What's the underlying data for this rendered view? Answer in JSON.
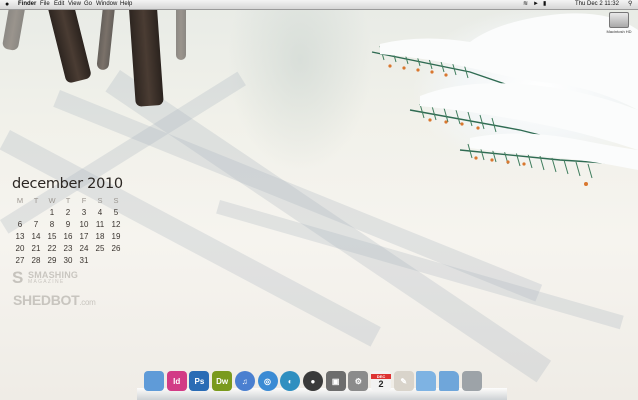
{
  "menubar": {
    "app": "Finder",
    "items": [
      "File",
      "Edit",
      "View",
      "Go",
      "Window",
      "Help"
    ],
    "clock": "Thu Dec 2  11:32",
    "spotlight_icon": "search-icon"
  },
  "desktop": {
    "hd_label": "Macintosh HD"
  },
  "calendar": {
    "title": "december 2010",
    "day_headers": [
      "M",
      "T",
      "W",
      "T",
      "F",
      "S",
      "S"
    ],
    "cells": [
      "",
      "",
      "1",
      "2",
      "3",
      "4",
      "5",
      "6",
      "7",
      "8",
      "9",
      "10",
      "11",
      "12",
      "13",
      "14",
      "15",
      "16",
      "17",
      "18",
      "19",
      "20",
      "21",
      "22",
      "23",
      "24",
      "25",
      "26",
      "27",
      "28",
      "29",
      "30",
      "31",
      "",
      ""
    ]
  },
  "branding": {
    "smashing_line1": "SMASHING",
    "smashing_line2": "MAGAZINE",
    "shedbot_name": "SHEDBOT",
    "shedbot_domain": ".com"
  },
  "dock": {
    "items": [
      {
        "name": "finder",
        "label": "",
        "color": "#5f9bd8"
      },
      {
        "name": "indesign",
        "label": "Id",
        "color": "#d23b86"
      },
      {
        "name": "photoshop",
        "label": "Ps",
        "color": "#2a6cb5"
      },
      {
        "name": "dreamweaver",
        "label": "Dw",
        "color": "#7a9a1d"
      },
      {
        "name": "itunes",
        "label": "♫",
        "color": "#4a7fd0"
      },
      {
        "name": "safari",
        "label": "◎",
        "color": "#3b8bd4"
      },
      {
        "name": "firefox",
        "label": "◐",
        "color": "#2f8fc0"
      },
      {
        "name": "camera",
        "label": "●",
        "color": "#3a3a3a"
      },
      {
        "name": "preview",
        "label": "▣",
        "color": "#6d6d6d"
      },
      {
        "name": "settings",
        "label": "⚙",
        "color": "#8b8b8b"
      },
      {
        "name": "calendar-app",
        "label": "2",
        "color": "#f2f2f2"
      },
      {
        "name": "utility",
        "label": "✎",
        "color": "#d9d4cb"
      },
      {
        "name": "folder-apps",
        "label": "",
        "color": "#7eb3e3"
      },
      {
        "name": "folder-downloads",
        "label": "",
        "color": "#6fa6da"
      },
      {
        "name": "trash",
        "label": "",
        "color": "#9da3a8"
      }
    ],
    "calendar_month": "DEC"
  }
}
